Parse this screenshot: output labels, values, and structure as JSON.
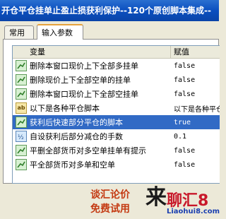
{
  "window": {
    "title": "开仓平仓挂单止盈止损获利保护--120个原创脚本集成--"
  },
  "tabs": [
    {
      "label": "常用"
    },
    {
      "label": "输入参数"
    }
  ],
  "params_table": {
    "columns": {
      "variable": "变量",
      "value": "赋值"
    },
    "rows": [
      {
        "icon": "bool-icon",
        "name": "删除本窗口现价上下全部多挂单",
        "value": "false"
      },
      {
        "icon": "bool-icon",
        "name": "删除现价上下全部空单的挂单",
        "value": "false"
      },
      {
        "icon": "bool-icon",
        "name": "删除本窗口现价上下全部空挂单",
        "value": "false"
      },
      {
        "icon": "text-icon",
        "name": "以下是各种平仓脚本",
        "value": "以下是各种平仓脚本"
      },
      {
        "icon": "bool-icon",
        "name": "获利后快速部分平仓的脚本",
        "value": "true",
        "selected": true
      },
      {
        "icon": "number-icon",
        "name": "自设获利后部分减仓的手数",
        "value": "0.1"
      },
      {
        "icon": "bool-icon",
        "name": "平删全部货币对多空单挂单有提示",
        "value": "false"
      },
      {
        "icon": "bool-icon",
        "name": "平全部货币对多单和空单",
        "value": "false"
      }
    ]
  },
  "watermark": {
    "line1": "谈汇论价",
    "line2": "免费试用",
    "brand_big": "来",
    "brand_mid": "聊汇",
    "brand_digit": "8",
    "brand_url": "Liaohui8.com"
  }
}
